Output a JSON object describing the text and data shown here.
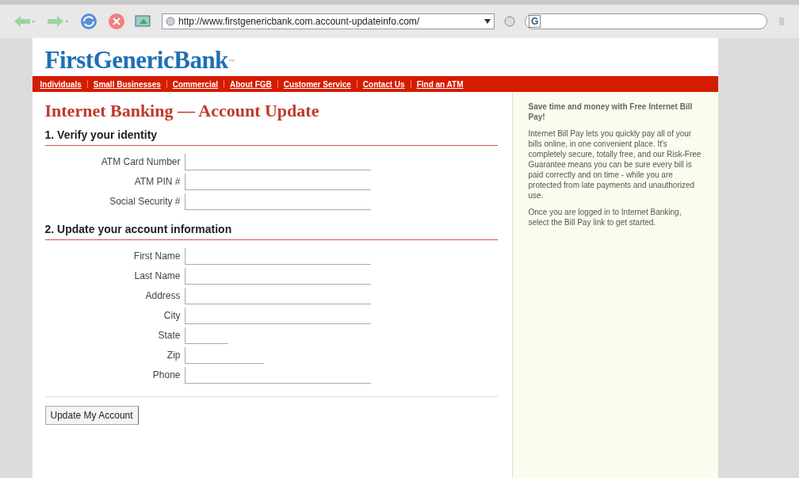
{
  "browser": {
    "url": "http://www.firstgenericbank.com.account-updateinfo.com/",
    "search_icon_text": "G"
  },
  "logo": {
    "text": "FirstGenericBank",
    "mark": "™"
  },
  "nav": [
    "Individuals",
    "Small Businesses",
    "Commercial",
    "About FGB",
    "Customer Service",
    "Contact Us",
    "Find an ATM"
  ],
  "heading": "Internet Banking — Account Update",
  "sections": [
    {
      "title": "1. Verify your identity",
      "fields": [
        {
          "label": "ATM Card Number",
          "kind": "long"
        },
        {
          "label": "ATM PIN #",
          "kind": "long"
        },
        {
          "label": "Social Security #",
          "kind": "long"
        }
      ]
    },
    {
      "title": "2. Update your account information",
      "fields": [
        {
          "label": "First Name",
          "kind": "long"
        },
        {
          "label": "Last Name",
          "kind": "long"
        },
        {
          "label": "Address",
          "kind": "long"
        },
        {
          "label": "City",
          "kind": "long"
        },
        {
          "label": "State",
          "kind": "short"
        },
        {
          "label": "Zip",
          "kind": "medium"
        },
        {
          "label": "Phone",
          "kind": "long"
        }
      ]
    }
  ],
  "submit": "Update My Account",
  "sidebar": {
    "title": "Save time and money with Free Internet Bill Pay!",
    "paragraphs": [
      "Internet Bill Pay lets you quickly pay all of your bills online, in one convenient place. It's completely secure, totally free, and our Risk-Free Guarantee means you can be sure every bill is paid correctly and on time - while you are protected from late payments and unauthorized use.",
      "Once you are logged in to Internet Banking, select the Bill Pay link to get started."
    ]
  }
}
